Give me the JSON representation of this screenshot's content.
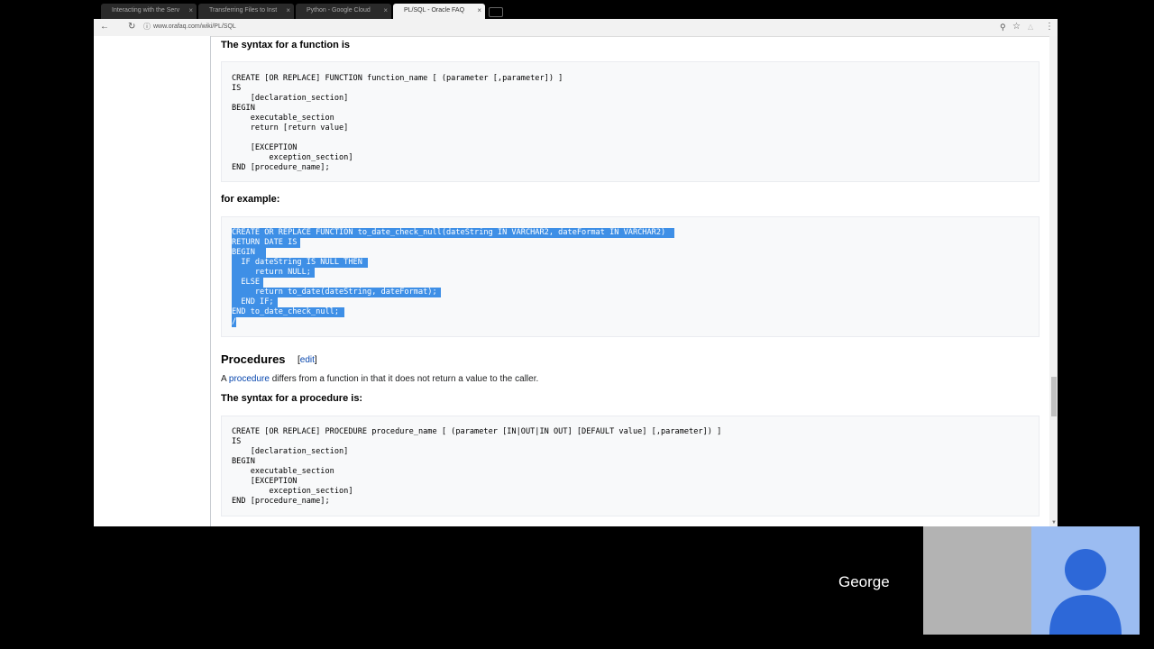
{
  "browser": {
    "tabs": [
      {
        "title": "Interacting with the Serv"
      },
      {
        "title": "Transferring Files to Inst"
      },
      {
        "title": "Python - Google Cloud"
      },
      {
        "title": "PL/SQL - Oracle FAQ"
      }
    ],
    "tab_close_glyph": "×",
    "url": "www.orafaq.com/wiki/PL/SQL",
    "icons": {
      "back": "back-arrow-icon",
      "reload": "reload-icon",
      "zoom": "zoom-icon",
      "bookmark": "star-icon",
      "menu": "menu-icon"
    }
  },
  "page": {
    "function_syntax_heading": "The syntax for a function is",
    "function_syntax_code": [
      "CREATE [OR REPLACE] FUNCTION function_name [ (parameter [,parameter]) ]",
      "IS",
      "    [declaration_section]",
      "BEGIN",
      "    executable_section",
      "    return [return value]",
      "",
      "    [EXCEPTION",
      "        exception_section]",
      "END [procedure_name];"
    ],
    "example_heading": "for example:",
    "example_code": [
      "CREATE OR REPLACE FUNCTION to_date_check_null(dateString IN VARCHAR2, dateFormat IN VARCHAR2)",
      "RETURN DATE IS",
      "BEGIN",
      "  IF dateString IS NULL THEN",
      "     return NULL;",
      "  ELSE",
      "     return to_date(dateString, dateFormat);",
      "  END IF;",
      "END to_date_check_null;",
      "/"
    ],
    "procedures_heading": "Procedures",
    "edit_link_open": "[",
    "edit_link": "edit",
    "edit_link_close": "]",
    "procedure_link": "procedure",
    "procedure_sentence_pre": "A ",
    "procedure_sentence_post": " differs from a function in that it does not return a value to the caller.",
    "procedure_syntax_heading": "The syntax for a procedure is:",
    "procedure_syntax_code": [
      "CREATE [OR REPLACE] PROCEDURE procedure_name [ (parameter [IN|OUT|IN OUT] [DEFAULT value] [,parameter]) ]",
      "IS",
      "    [declaration_section]",
      "BEGIN",
      "    executable_section",
      "    [EXCEPTION",
      "        exception_section]",
      "END [procedure_name];"
    ]
  },
  "call": {
    "participant_name": "George"
  },
  "colors": {
    "selection": "#3e8fe6",
    "link": "#0645ad",
    "avatar_bg": "#9bbcf1",
    "avatar_fg": "#2d68d8"
  }
}
